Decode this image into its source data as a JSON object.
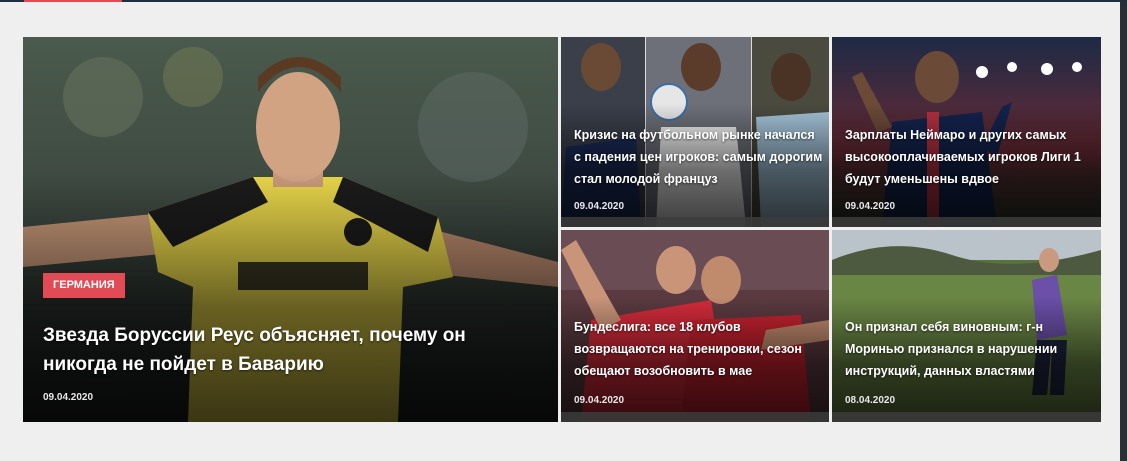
{
  "colors": {
    "accent": "#e24b55",
    "panel_bg": "#efefef",
    "top_border": "#1f2f3f"
  },
  "featured": {
    "tag": "ГЕРМАНИЯ",
    "title": "Звезда Боруссии Реус объясняет, почему он никогда не пойдет в Баварию",
    "date": "09.04.2020"
  },
  "articles": [
    {
      "title": "Кризис на футбольном рынке начался с падения цен игроков: самым дорогим стал молодой француз",
      "date": "09.04.2020"
    },
    {
      "title": "Зарплаты Неймаро и других самых высокооплачиваемых игроков Лиги 1 будут уменьшены вдвое",
      "date": "09.04.2020"
    },
    {
      "title": "Бундеслига: все 18 клубов возвращаются на тренировки, сезон обещают возобновить в мае",
      "date": "09.04.2020"
    },
    {
      "title": "Он признал себя виновным: г-н Моринью признался в нарушении инструкций, данных властями",
      "date": "08.04.2020"
    }
  ]
}
